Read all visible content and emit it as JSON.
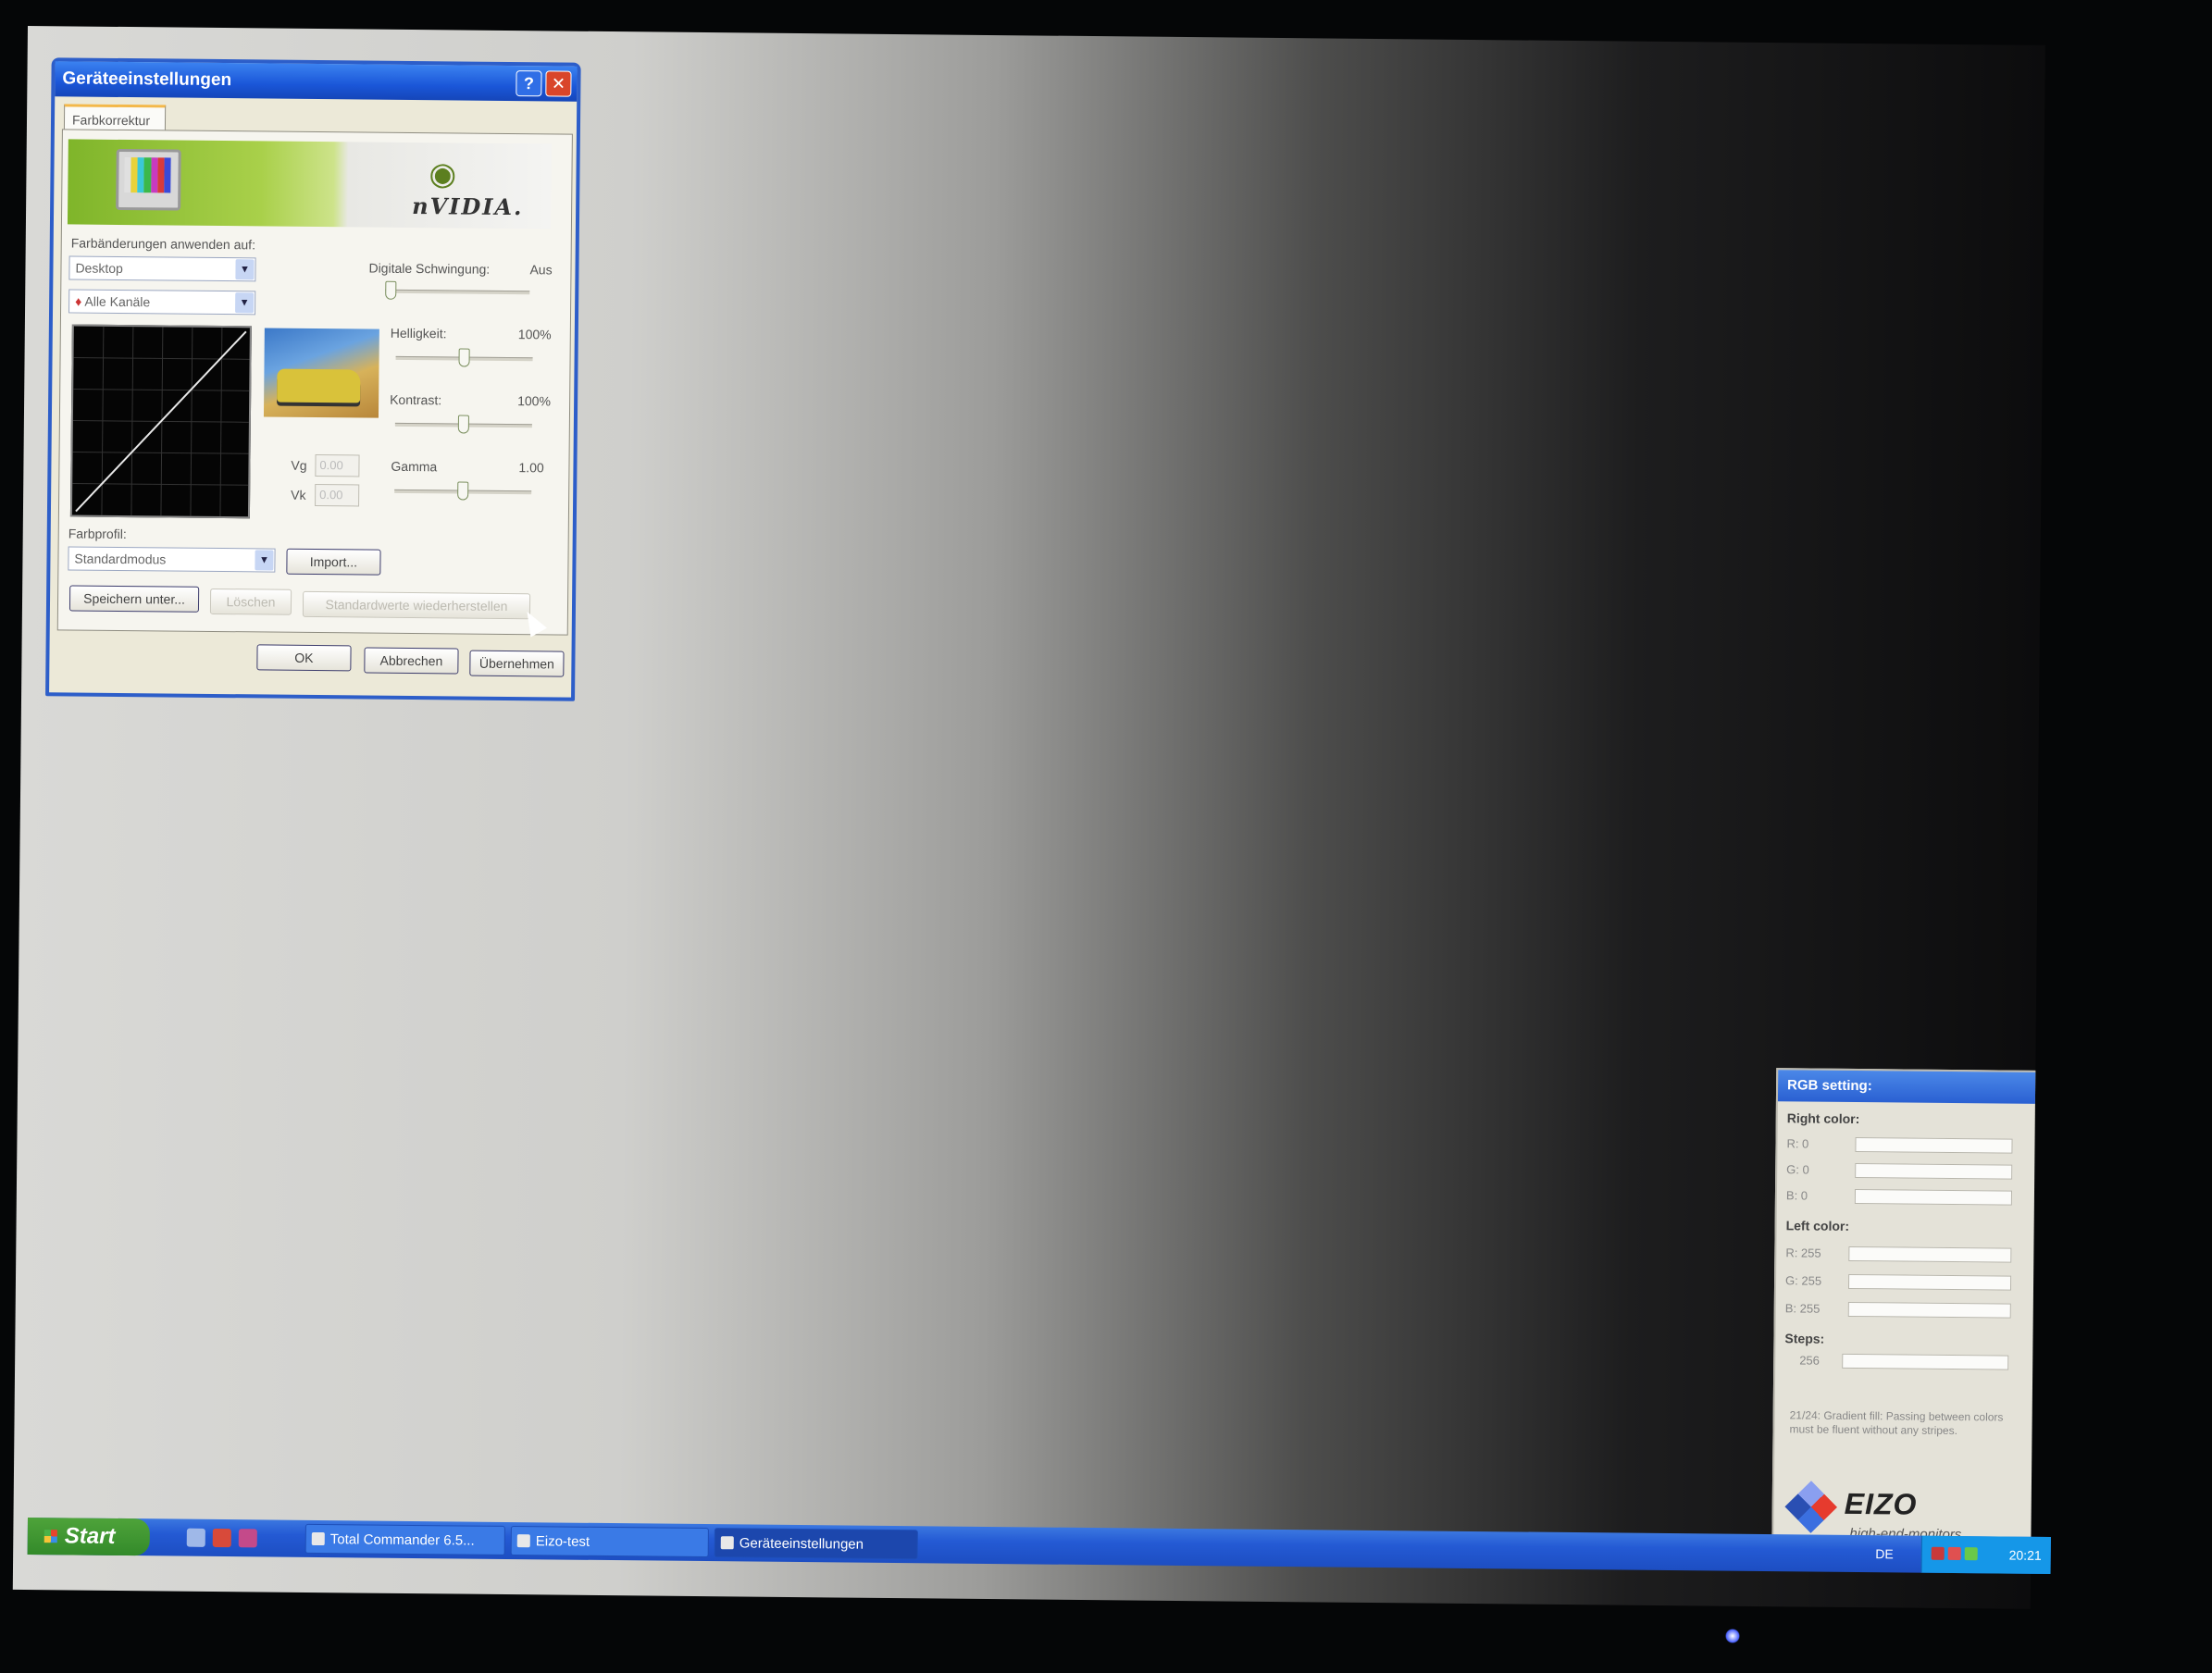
{
  "dialog": {
    "title": "Geräteeinstellungen",
    "help_glyph": "?",
    "close_glyph": "✕",
    "tab_label": "Farbkorrektur",
    "banner_brand": "nVIDIA.",
    "apply_label": "Farbänderungen anwenden auf:",
    "target_combo": "Desktop",
    "channel_combo": "Alle Kanäle",
    "digital_label": "Digitale Schwingung:",
    "digital_value": "Aus",
    "brightness_label": "Helligkeit:",
    "brightness_value": "100%",
    "contrast_label": "Kontrast:",
    "contrast_value": "100%",
    "gamma_label": "Gamma",
    "gamma_value": "1.00",
    "vg_label": "Vg",
    "vg_value": "0.00",
    "vk_label": "Vk",
    "vk_value": "0.00",
    "profile_label": "Farbprofil:",
    "profile_combo": "Standardmodus",
    "import_button": "Import...",
    "save_as_button": "Speichern unter...",
    "delete_button": "Löschen",
    "restore_button": "Standardwerte wiederherstellen",
    "ok_button": "OK",
    "cancel_button": "Abbrechen",
    "apply_button": "Übernehmen"
  },
  "sliders": {
    "digital_fraction": 0.0,
    "brightness_fraction": 0.5,
    "contrast_fraction": 0.5,
    "gamma_fraction": 0.5
  },
  "eizo": {
    "title": "RGB setting:",
    "right_header": "Right color:",
    "right_r": "R: 0",
    "right_g": "G: 0",
    "right_b": "B: 0",
    "left_header": "Left color:",
    "left_r": "R: 255",
    "left_g": "G: 255",
    "left_b": "B: 255",
    "steps_header": "Steps:",
    "steps_value": "256",
    "note": "21/24: Gradient fill: Passing between colors must be fluent without any stripes.",
    "logo_word": "EIZO",
    "logo_sub": "high-end-monitors"
  },
  "taskbar": {
    "start_label": "Start",
    "tasks": [
      "Total Commander 6.5...",
      "Eizo-test",
      "Geräteeinstellungen"
    ],
    "language": "DE",
    "clock": "20:21"
  },
  "colors": {
    "xp_blue": "#245ad4",
    "start_green": "#338a2a",
    "nvidia_green": "#7fb52a"
  }
}
